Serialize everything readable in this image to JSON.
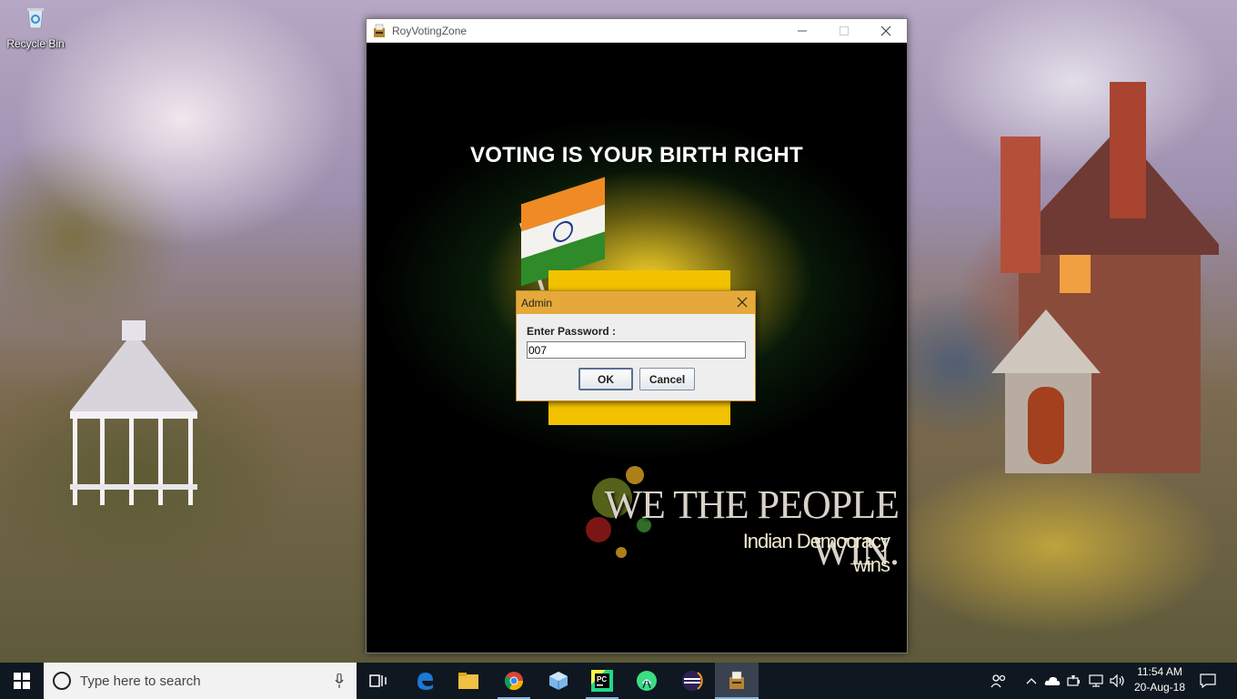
{
  "desktop": {
    "recycle_bin_label": "Recycle Bin"
  },
  "app_window": {
    "title": "RoyVotingZone",
    "headline": "VOTING IS YOUR BIRTH RIGHT",
    "tagline": "WE THE PEOPLE WIN.",
    "subtagline": "Indian Democracy wins"
  },
  "dialog": {
    "title": "Admin",
    "prompt_label": "Enter Password :",
    "password_value": "007",
    "ok_label": "OK",
    "cancel_label": "Cancel"
  },
  "taskbar": {
    "search_placeholder": "Type here to search",
    "pinned_icons": [
      "task-view-icon",
      "edge-icon",
      "file-explorer-icon",
      "chrome-icon",
      "virtualbox-icon",
      "pycharm-icon",
      "android-studio-icon",
      "eclipse-icon",
      "voting-app-icon"
    ],
    "active_app": "voting-app-icon",
    "tray_icons": [
      "people-icon",
      "chevron-up-icon",
      "onedrive-icon",
      "power-icon",
      "network-icon",
      "volume-icon"
    ],
    "clock_time": "11:54 AM",
    "clock_date": "20-Aug-18",
    "notification_icon": "action-center-icon"
  },
  "colors": {
    "dialog_titlebar": "#e5a93b",
    "headline_text": "#ffffff",
    "taskbar_bg": "#0f1820",
    "accent": "#7eb4ea"
  }
}
